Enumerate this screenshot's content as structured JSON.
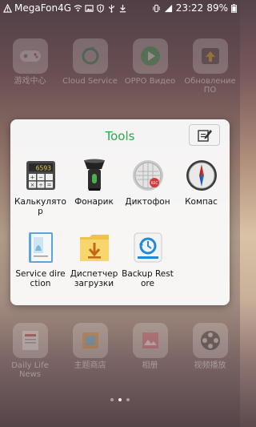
{
  "status_bar": {
    "carrier": "MegaFon4G",
    "time": "23:22",
    "battery": "89%"
  },
  "folder": {
    "title": "Tools",
    "apps": [
      {
        "label": "Калькулятор",
        "icon": "calculator-icon"
      },
      {
        "label": "Фонарик",
        "icon": "flashlight-icon"
      },
      {
        "label": "Диктофон",
        "icon": "voice-recorder-icon"
      },
      {
        "label": "Компас",
        "icon": "compass-icon"
      },
      {
        "label": "Service direction",
        "icon": "service-direction-icon"
      },
      {
        "label": "Диспетчер загрузки",
        "icon": "download-manager-icon"
      },
      {
        "label": "Backup Restore",
        "icon": "backup-restore-icon"
      }
    ]
  },
  "home": {
    "row1": [
      {
        "label": "游戏中心",
        "icon": "game-controller-icon"
      },
      {
        "label": "Cloud Service",
        "icon": "cloud-service-icon"
      },
      {
        "label": "OPPO Видео",
        "icon": "oppo-video-icon"
      },
      {
        "label": "Обновление ПО",
        "icon": "software-update-icon"
      }
    ],
    "row2": [
      {
        "label": "Daily Life News",
        "icon": "news-icon"
      },
      {
        "label": "主题商店",
        "icon": "theme-store-icon"
      },
      {
        "label": "相册",
        "icon": "gallery-icon"
      },
      {
        "label": "视频播放",
        "icon": "video-player-icon"
      }
    ]
  },
  "colors": {
    "folder_title": "#2da84a",
    "folder_bg": "#fafafa"
  }
}
